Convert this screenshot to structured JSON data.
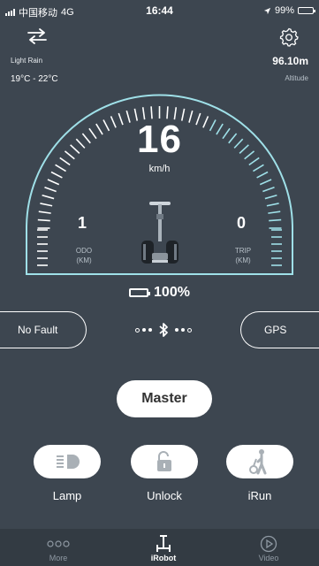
{
  "status": {
    "carrier": "中国移动",
    "network": "4G",
    "time": "16:44",
    "battery": "99%",
    "battery_level": 0.99
  },
  "weather": {
    "condition": "Light Rain",
    "temp_range": "19°C - 22°C"
  },
  "altitude": {
    "value": "96.10m",
    "label": "Altitude"
  },
  "speed": {
    "value": "16",
    "unit": "km/h",
    "gauge_fraction": 0.6
  },
  "odo": {
    "value": "1",
    "label_line1": "ODO",
    "label_line2": "(KM)"
  },
  "trip": {
    "value": "0",
    "label_line1": "TRIP",
    "label_line2": "(KM)"
  },
  "battery": {
    "percent": "100%",
    "level": 1.0
  },
  "fault": {
    "label": "No Fault"
  },
  "gps": {
    "label": "GPS"
  },
  "mode": {
    "label": "Master"
  },
  "controls": [
    {
      "label": "Lamp",
      "icon": "headlamp-icon"
    },
    {
      "label": "Unlock",
      "icon": "unlock-icon"
    },
    {
      "label": "iRun",
      "icon": "irun-icon"
    }
  ],
  "tabs": [
    {
      "label": "More",
      "icon": "more-icon"
    },
    {
      "label": "iRobot",
      "icon": "robot-icon"
    },
    {
      "label": "Video",
      "icon": "play-icon"
    }
  ],
  "colors": {
    "background": "#3d4650",
    "gauge": "#9fe0e8",
    "tabbar": "#333b43"
  }
}
